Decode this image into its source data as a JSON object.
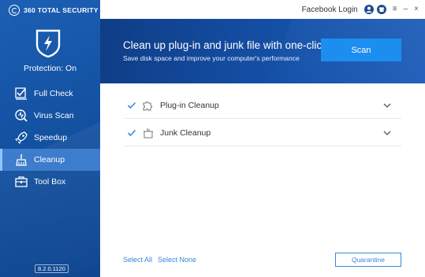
{
  "app": {
    "brand": "360 TOTAL SECURITY",
    "version": "8.2.0.1120",
    "protection_status": "Protection: On"
  },
  "topbar": {
    "facebook_login": "Facebook Login",
    "minimize": "–",
    "close": "×",
    "menu": "≡"
  },
  "sidebar": {
    "items": [
      {
        "label": "Full Check",
        "icon": "full-check-icon"
      },
      {
        "label": "Virus Scan",
        "icon": "virus-scan-icon"
      },
      {
        "label": "Speedup",
        "icon": "rocket-icon"
      },
      {
        "label": "Cleanup",
        "icon": "broom-icon"
      },
      {
        "label": "Tool Box",
        "icon": "toolbox-icon"
      }
    ],
    "active": "Cleanup"
  },
  "banner": {
    "title": "Clean up plug-in and junk file with one-click",
    "subtitle": "Save disk space and improve your computer's performance",
    "scan_button": "Scan"
  },
  "cleanup_list": [
    {
      "label": "Plug-in Cleanup",
      "checked": true,
      "icon": "puzzle-icon"
    },
    {
      "label": "Junk Cleanup",
      "checked": true,
      "icon": "trash-bin-icon"
    }
  ],
  "footer": {
    "select_all": "Select All",
    "select_none": "Select None",
    "quarantine": "Quarantine"
  },
  "colors": {
    "sidebar": "#124f9e",
    "banner": "#1552aa",
    "scan_button": "#1b8ef0",
    "link": "#3a86d9",
    "active_nav": "#3e7ccc"
  }
}
